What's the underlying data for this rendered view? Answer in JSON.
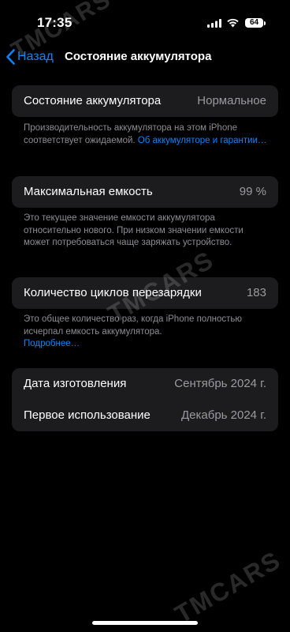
{
  "status": {
    "time": "17:35",
    "battery": "64"
  },
  "nav": {
    "back_label": "Назад",
    "title": "Состояние аккумулятора"
  },
  "condition": {
    "label": "Состояние аккумулятора",
    "value": "Нормальное",
    "footer_text": "Производительность аккумулятора на этом iPhone соответствует ожидаемой.",
    "footer_link": "Об аккумуляторе и гарантии…"
  },
  "capacity": {
    "label": "Максимальная емкость",
    "value": "99 %",
    "footer_text": "Это текущее значение емкости аккумулятора относительно нового. При низком значении емкости может потребоваться чаще заряжать устройство."
  },
  "cycles": {
    "label": "Количество циклов перезарядки",
    "value": "183",
    "footer_text": "Это общее количество раз, когда iPhone полностью исчерпал емкость аккумулятора.",
    "footer_link": "Подробнее…"
  },
  "dates": {
    "manufacture_label": "Дата изготовления",
    "manufacture_value": "Сентябрь 2024 г.",
    "first_use_label": "Первое использование",
    "first_use_value": "Декабрь 2024 г."
  },
  "watermark": "TMCARS",
  "colors": {
    "accent": "#0a84ff",
    "card": "#1c1c1e",
    "secondary_text": "#8d8d93"
  }
}
